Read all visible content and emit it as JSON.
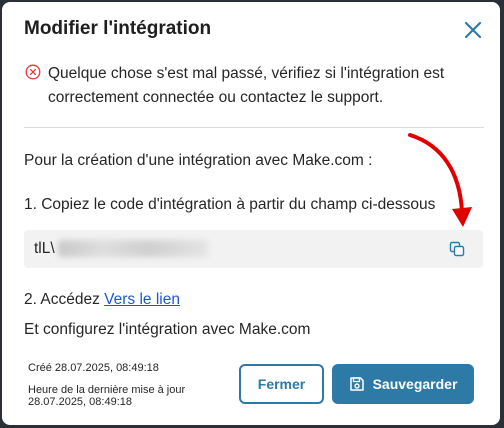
{
  "modal": {
    "title": "Modifier l'intégration",
    "error_message": "Quelque chose s'est mal passé, vérifiez si l'intégration est correctement connectée ou contactez le support.",
    "intro": "Pour la création d'une intégration avec Make.com :",
    "step1": "1. Copiez le code d'intégration à partir du champ ci-dessous",
    "code_visible_prefix": "tlL\\",
    "step2_prefix": "2. Accédez ",
    "step2_link": "Vers le lien",
    "step3": "Et configurez l'intégration avec Make.com",
    "created": "Créé 28.07.2025, 08:49:18",
    "updated_label": "Heure de la dernière mise à jour",
    "updated_value": "28.07.2025, 08:49:18",
    "cancel_label": "Fermer",
    "save_label": "Sauvegarder"
  },
  "colors": {
    "accent": "#2e7aa6",
    "error": "#e53935",
    "link": "#1a56d6",
    "annotation_arrow": "#e00000"
  },
  "icons": [
    "close-icon",
    "error-circle-icon",
    "copy-icon",
    "save-disk-icon"
  ]
}
